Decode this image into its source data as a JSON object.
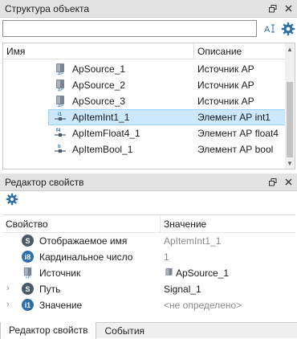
{
  "object_panel": {
    "title": "Структура объекта",
    "search": {
      "value": "",
      "placeholder": ""
    },
    "columns": {
      "name": "Имя",
      "description": "Описание"
    },
    "rows": [
      {
        "name": "ApSource_1",
        "description": "Источник АР",
        "icon": "source-icon",
        "selected": false
      },
      {
        "name": "ApSource_2",
        "description": "Источник АР",
        "icon": "source-icon",
        "selected": false
      },
      {
        "name": "ApSource_3",
        "description": "Источник АР",
        "icon": "source-icon",
        "selected": false
      },
      {
        "name": "ApItemInt1_1",
        "description": "Элемент АР int1",
        "icon": "int-icon",
        "selected": true
      },
      {
        "name": "ApItemFloat4_1",
        "description": "Элемент АР float4",
        "icon": "float-icon",
        "selected": false
      },
      {
        "name": "ApItemBool_1",
        "description": "Элемент АР bool",
        "icon": "bool-icon",
        "selected": false
      }
    ]
  },
  "props_panel": {
    "title": "Редактор свойств",
    "columns": {
      "property": "Свойство",
      "value": "Значение"
    },
    "rows": [
      {
        "label": "Отображаемое имя",
        "value": "ApItemInt1_1",
        "icon": "s",
        "expandable": false,
        "value_gray": true
      },
      {
        "label": "Кардинальное число",
        "value": "1",
        "icon": "i8",
        "expandable": false,
        "value_gray": true
      },
      {
        "label": "Источник",
        "value": "ApSource_1",
        "icon": "source-icon",
        "expandable": false,
        "value_gray": false
      },
      {
        "label": "Путь",
        "value": "Signal_1",
        "icon": "s",
        "expandable": true,
        "value_gray": false
      },
      {
        "label": "Значение",
        "value": "<не определено>",
        "icon": "i1",
        "expandable": true,
        "value_gray": true
      }
    ]
  },
  "tabs": [
    {
      "label": "Редактор свойств",
      "active": true
    },
    {
      "label": "События",
      "active": false
    }
  ],
  "icons": {
    "float": "⧉",
    "close": "✕"
  },
  "colors": {
    "selection": "#cce8ff",
    "accent": "#2d6fa8",
    "header": "#e3e3e3"
  }
}
